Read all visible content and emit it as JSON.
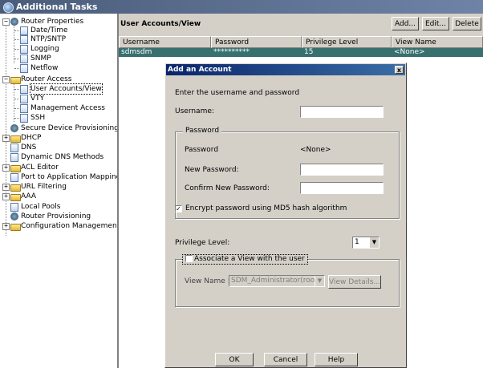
{
  "window": {
    "title": "Additional Tasks"
  },
  "tree": [
    {
      "label": "Router Properties",
      "expander": "−",
      "icon": "gear-icon"
    },
    {
      "label": "Date/Time",
      "icon": "doc-icon"
    },
    {
      "label": "NTP/SNTP",
      "icon": "doc-icon"
    },
    {
      "label": "Logging",
      "icon": "doc-icon"
    },
    {
      "label": "SNMP",
      "icon": "doc-icon"
    },
    {
      "label": "Netflow",
      "icon": "doc-icon"
    },
    {
      "label": "Router Access",
      "expander": "−",
      "icon": "folder-icon"
    },
    {
      "label": "User Accounts/View",
      "icon": "user-icon",
      "selected": true
    },
    {
      "label": "VTY",
      "icon": "doc-icon"
    },
    {
      "label": "Management Access",
      "icon": "doc-icon"
    },
    {
      "label": "SSH",
      "icon": "doc-icon"
    },
    {
      "label": "Secure Device Provisioning",
      "icon": "gear-icon"
    },
    {
      "label": "DHCP",
      "expander": "+",
      "icon": "folder-icon"
    },
    {
      "label": "DNS",
      "icon": "doc-icon"
    },
    {
      "label": "Dynamic DNS Methods",
      "icon": "doc-icon"
    },
    {
      "label": "ACL Editor",
      "expander": "+",
      "icon": "folder-icon"
    },
    {
      "label": "Port to Application Mappings",
      "icon": "doc-icon"
    },
    {
      "label": "URL Filtering",
      "expander": "+",
      "icon": "folder-icon"
    },
    {
      "label": "AAA",
      "expander": "+",
      "icon": "folder-icon"
    },
    {
      "label": "Local Pools",
      "icon": "doc-icon"
    },
    {
      "label": "Router Provisioning",
      "icon": "gear-icon"
    },
    {
      "label": "Configuration Management",
      "expander": "+",
      "icon": "folder-icon"
    }
  ],
  "panel": {
    "title": "User Accounts/View",
    "buttons": {
      "add": "Add...",
      "edit": "Edit...",
      "delete": "Delete"
    },
    "columns": [
      "Username",
      "Password",
      "Privilege Level",
      "View Name"
    ],
    "rows": [
      {
        "username": "sdmsdm",
        "password": "**********",
        "privilege": "15",
        "view": "<None>"
      }
    ]
  },
  "dialog": {
    "title": "Add an Account",
    "close": "x",
    "intro": "Enter the username and password",
    "username_label": "Username:",
    "username_value": "",
    "password_group": "Password",
    "password_label": "Password",
    "password_value": "<None>",
    "new_password_label": "New Password:",
    "confirm_password_label": "Confirm New Password:",
    "encrypt_label": "Encrypt password using MD5 hash algorithm",
    "encrypt_checked": true,
    "privilege_label": "Privilege Level:",
    "privilege_value": "1",
    "associate_label": "Associate a View with the user",
    "associate_checked": false,
    "view_name_label": "View Name :",
    "view_name_value": "SDM_Administrator(root)",
    "view_details": "View Details...",
    "ok": "OK",
    "cancel": "Cancel",
    "help": "Help"
  },
  "colors": {
    "selected_row": "#386f6f",
    "dialog_title": "#0a246a",
    "window_title": "#4a5c7a"
  }
}
